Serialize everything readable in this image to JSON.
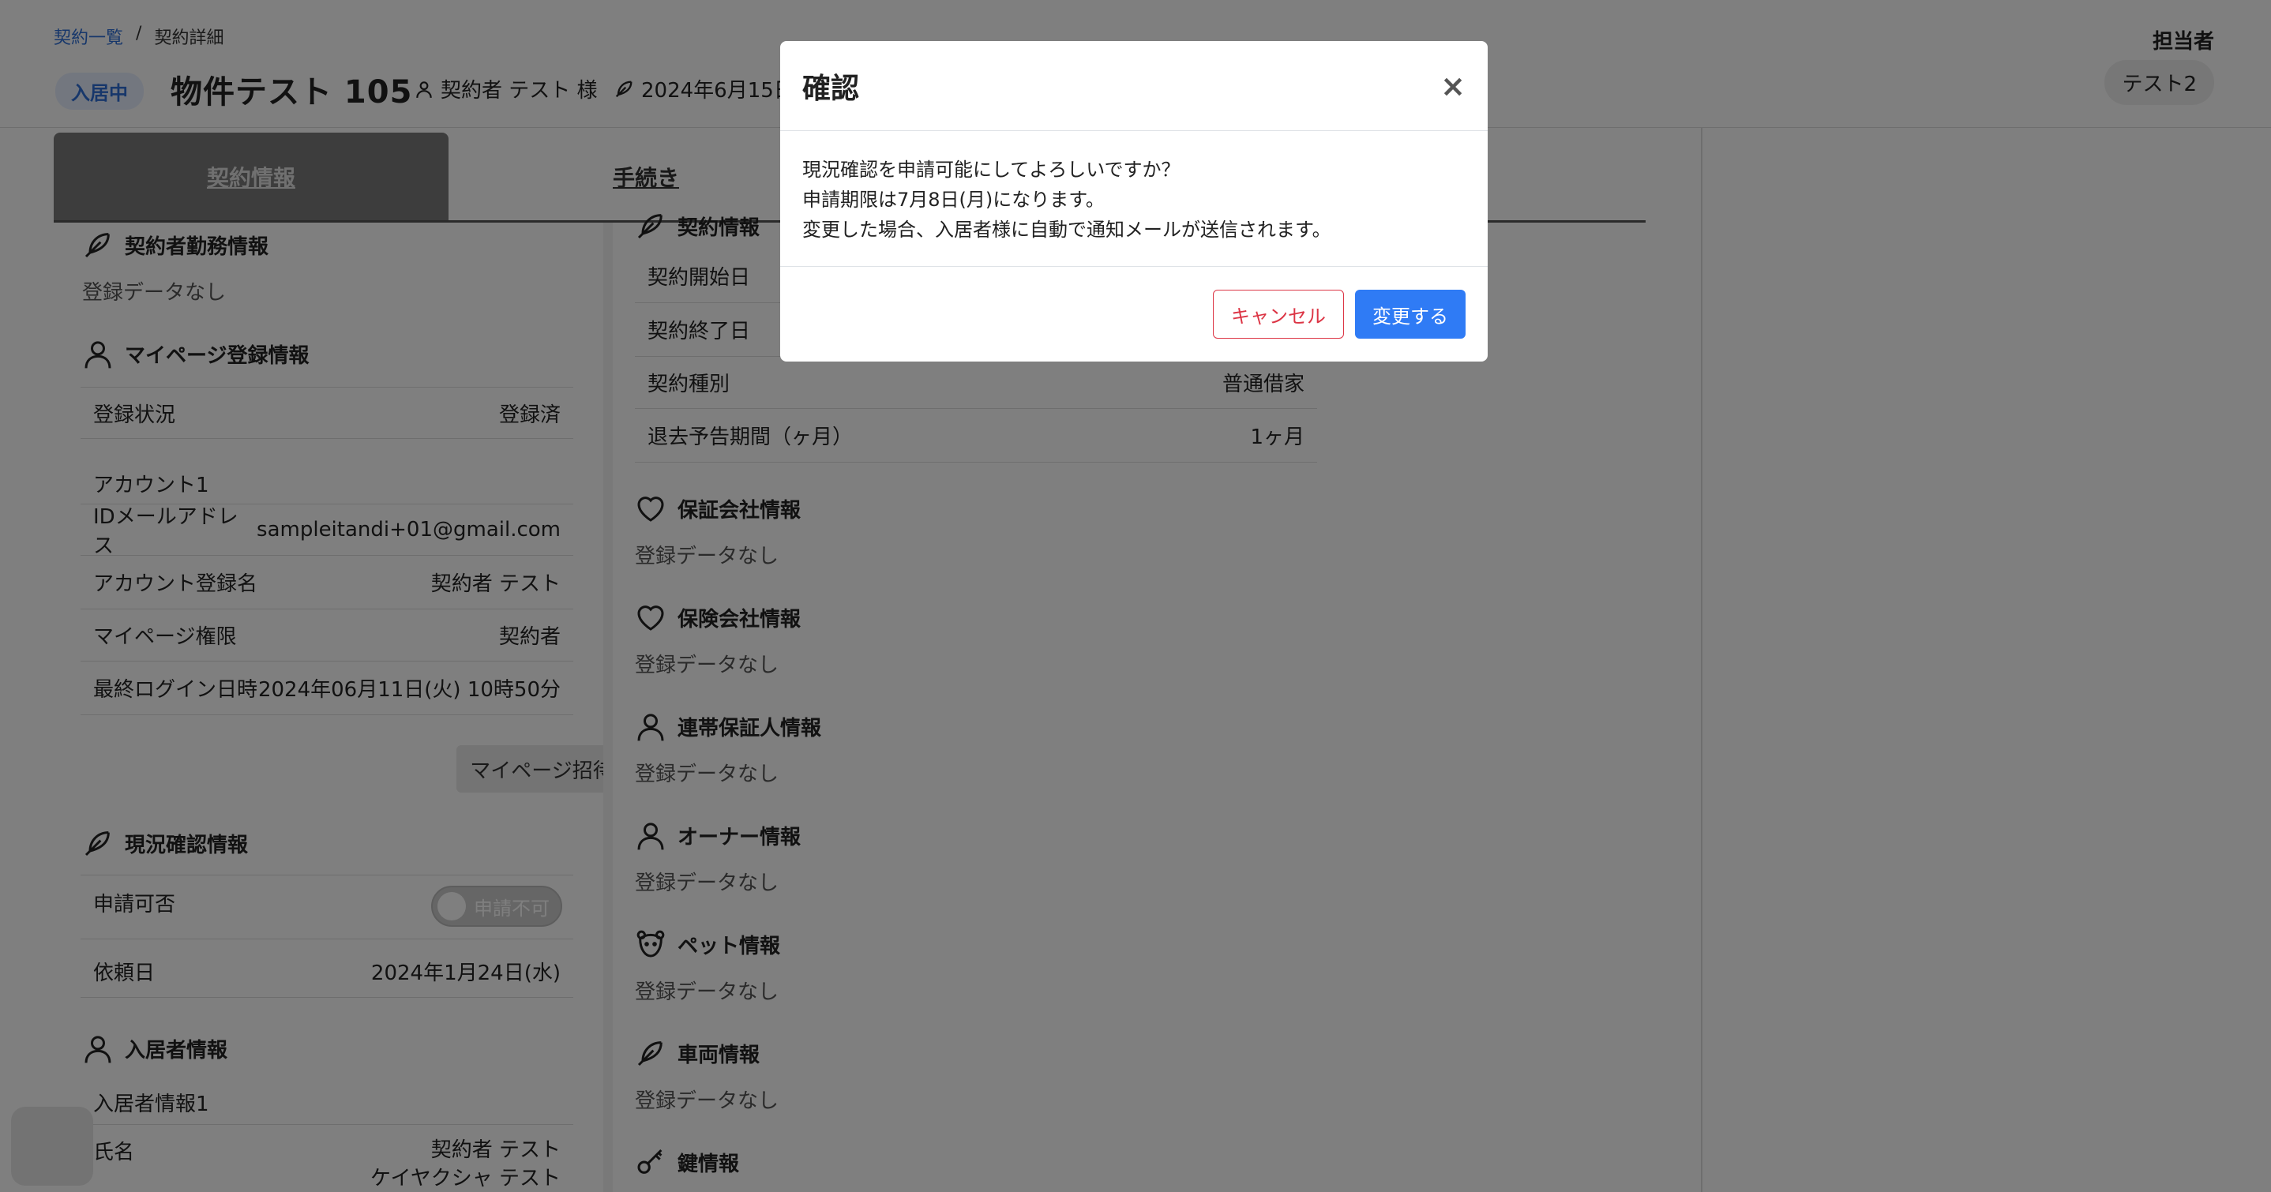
{
  "breadcrumb": {
    "root": "契約一覧",
    "separator": "/",
    "current": "契約詳細"
  },
  "header": {
    "status": "入居中",
    "property_title": "物件テスト 105",
    "contractor": "契約者 テスト 様",
    "date": "2024年6月15日",
    "staff_label": "担当者",
    "staff_name": "テスト2"
  },
  "tabs": [
    {
      "label": "契約情報"
    },
    {
      "label": "手続き"
    }
  ],
  "left": {
    "employment": {
      "title": "契約者勤務情報",
      "nodata": "登録データなし"
    },
    "mypage": {
      "title": "マイページ登録情報",
      "status_label": "登録状況",
      "status_value": "登録済",
      "account_heading": "アカウント1",
      "email_label": "IDメールアドレス",
      "email_value": "sampleitandi+01@gmail.com",
      "account_name_label": "アカウント登録名",
      "account_name_value": "契約者 テスト",
      "permission_label": "マイページ権限",
      "permission_value": "契約者",
      "last_login_label": "最終ログイン日時",
      "last_login_value": "2024年06月11日(火) 10時50分",
      "invite_button": "マイページ招待"
    },
    "current_check": {
      "title": "現況確認情報",
      "apply_label": "申請可否",
      "toggle_label": "申請不可",
      "request_date_label": "依頼日",
      "request_date_value": "2024年1月24日(水)"
    },
    "resident": {
      "title": "入居者情報",
      "heading": "入居者情報1",
      "name_label": "氏名",
      "name_value": "契約者 テスト",
      "kana_value": "ケイヤクシャ テスト"
    }
  },
  "right": {
    "contract": {
      "title": "契約情報",
      "rows": [
        {
          "label": "契約開始日",
          "value": ""
        },
        {
          "label": "契約終了日",
          "value": ""
        },
        {
          "label": "契約種別",
          "value": "普通借家"
        },
        {
          "label": "退去予告期間（ヶ月）",
          "value": "1ヶ月"
        }
      ]
    },
    "sections": [
      {
        "title": "保証会社情報",
        "nodata": "登録データなし",
        "icon": "heart-icon"
      },
      {
        "title": "保険会社情報",
        "nodata": "登録データなし",
        "icon": "heart-icon"
      },
      {
        "title": "連帯保証人情報",
        "nodata": "登録データなし",
        "icon": "person-icon"
      },
      {
        "title": "オーナー情報",
        "nodata": "登録データなし",
        "icon": "person-icon"
      },
      {
        "title": "ペット情報",
        "nodata": "登録データなし",
        "icon": "pet-icon"
      },
      {
        "title": "車両情報",
        "nodata": "登録データなし",
        "icon": "feather-icon"
      },
      {
        "title": "鍵情報",
        "nodata": "",
        "icon": "key-icon"
      }
    ]
  },
  "modal": {
    "title": "確認",
    "close": "×",
    "line1": "現況確認を申請可能にしてよろしいですか？",
    "line2": "申請期限は7月8日(月)になります。",
    "line3": "変更した場合、入居者様に自動で通知メールが送信されます。",
    "cancel": "キャンセル",
    "confirm": "変更する"
  },
  "colors": {
    "accent": "#2f7bf5",
    "danger": "#dc3545",
    "overlay": "rgba(0,0,0,0.5)"
  }
}
